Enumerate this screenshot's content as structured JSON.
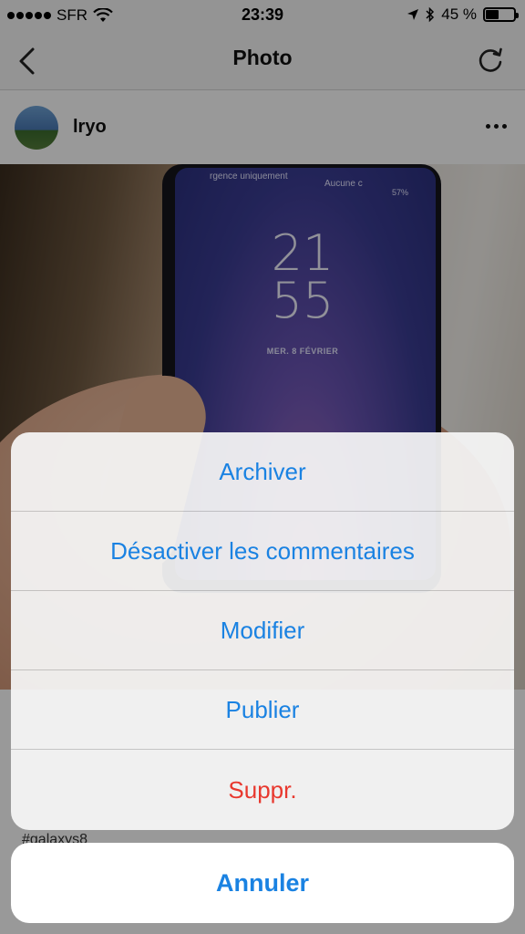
{
  "status_bar": {
    "carrier": "SFR",
    "time": "23:39",
    "battery_percent": "45 %",
    "battery_level": 0.45,
    "icons": [
      "signal-dots-icon",
      "wifi-icon",
      "location-arrow-icon",
      "bluetooth-icon",
      "battery-icon"
    ]
  },
  "nav": {
    "title": "Photo",
    "back_icon": "chevron-left-icon",
    "refresh_icon": "refresh-icon"
  },
  "post": {
    "username": "lryo",
    "more_icon": "more-icon",
    "caption_fragment": "#galaxys8"
  },
  "photo": {
    "phone_top_text": "rgence uniquement",
    "phone_carrier": "Aucune c",
    "phone_battery": "57%",
    "clock_hours": "21",
    "clock_minutes": "55",
    "date": "MER. 8 FÉVRIER"
  },
  "action_sheet": {
    "items": [
      {
        "label": "Archiver",
        "style": "default"
      },
      {
        "label": "Désactiver les commentaires",
        "style": "default"
      },
      {
        "label": "Modifier",
        "style": "default"
      },
      {
        "label": "Publier",
        "style": "default"
      },
      {
        "label": "Suppr.",
        "style": "destructive"
      }
    ],
    "cancel_label": "Annuler",
    "colors": {
      "accent": "#1a82e2",
      "destructive": "#e8382e"
    }
  }
}
